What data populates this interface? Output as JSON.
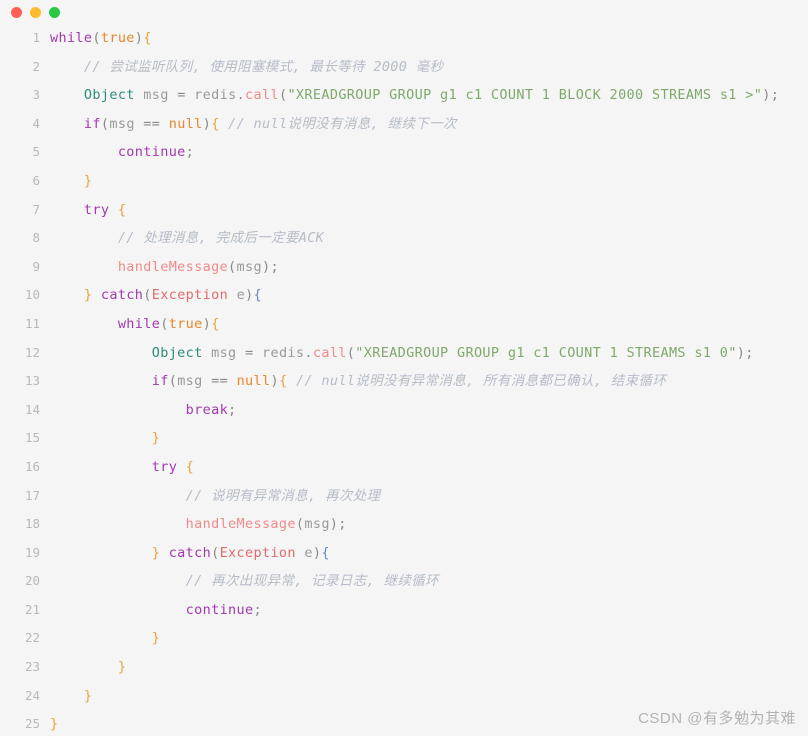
{
  "window": {
    "controls": [
      {
        "name": "close",
        "color": "#ff5f57"
      },
      {
        "name": "minimize",
        "color": "#febc2e"
      },
      {
        "name": "maximize",
        "color": "#28c840"
      }
    ]
  },
  "editor": {
    "background": "#f5f5f5",
    "gutter_color": "#b9b9b9",
    "language": "java",
    "lines": [
      {
        "number": "1",
        "indent": 0,
        "text": "while(true){"
      },
      {
        "number": "2",
        "indent": 1,
        "text": "// 尝试监听队列, 使用阻塞模式, 最长等待 2000 毫秒"
      },
      {
        "number": "3",
        "indent": 1,
        "text": "Object msg = redis.call(\"XREADGROUP GROUP g1 c1 COUNT 1 BLOCK 2000 STREAMS s1 >\");"
      },
      {
        "number": "4",
        "indent": 1,
        "text": "if(msg == null){ // null说明没有消息, 继续下一次"
      },
      {
        "number": "5",
        "indent": 2,
        "text": "continue;"
      },
      {
        "number": "6",
        "indent": 1,
        "text": "}"
      },
      {
        "number": "7",
        "indent": 1,
        "text": "try {"
      },
      {
        "number": "8",
        "indent": 2,
        "text": "// 处理消息, 完成后一定要ACK"
      },
      {
        "number": "9",
        "indent": 2,
        "text": "handleMessage(msg);"
      },
      {
        "number": "10",
        "indent": 1,
        "text": "} catch(Exception e){"
      },
      {
        "number": "11",
        "indent": 2,
        "text": "while(true){"
      },
      {
        "number": "12",
        "indent": 3,
        "text": "Object msg = redis.call(\"XREADGROUP GROUP g1 c1 COUNT 1 STREAMS s1 0\");"
      },
      {
        "number": "13",
        "indent": 3,
        "text": "if(msg == null){ // null说明没有异常消息, 所有消息都已确认, 结束循环"
      },
      {
        "number": "14",
        "indent": 4,
        "text": "break;"
      },
      {
        "number": "15",
        "indent": 3,
        "text": "}"
      },
      {
        "number": "16",
        "indent": 3,
        "text": "try {"
      },
      {
        "number": "17",
        "indent": 4,
        "text": "// 说明有异常消息, 再次处理"
      },
      {
        "number": "18",
        "indent": 4,
        "text": "handleMessage(msg);"
      },
      {
        "number": "19",
        "indent": 3,
        "text": "} catch(Exception e){"
      },
      {
        "number": "20",
        "indent": 4,
        "text": "// 再次出现异常, 记录日志, 继续循环"
      },
      {
        "number": "21",
        "indent": 4,
        "text": "continue;"
      },
      {
        "number": "22",
        "indent": 3,
        "text": "}"
      },
      {
        "number": "23",
        "indent": 2,
        "text": "}"
      },
      {
        "number": "24",
        "indent": 1,
        "text": "}"
      },
      {
        "number": "25",
        "indent": 0,
        "text": "}"
      }
    ]
  },
  "watermark": {
    "text": "CSDN @有多勉为其难"
  }
}
